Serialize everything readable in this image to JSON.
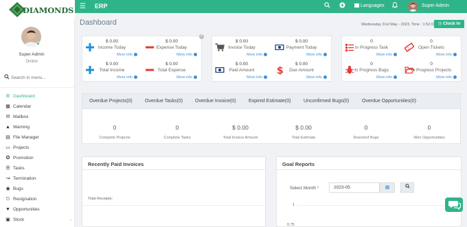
{
  "brand": {
    "logo_text": "DIAMONDS",
    "accent": "#2fb48a"
  },
  "topbar": {
    "app_title": "ERP",
    "languages_label": "Languages",
    "user_name": "Super Admin"
  },
  "sidebar": {
    "user_name": "Super Admin",
    "user_status": "Online",
    "search_placeholder": "Search in menu...",
    "items": [
      {
        "label": "Dashboard",
        "icon": "dashboard-icon",
        "active": true
      },
      {
        "label": "Calendar",
        "icon": "calendar-icon"
      },
      {
        "label": "Mailbox",
        "icon": "mailbox-icon"
      },
      {
        "label": "Warning",
        "icon": "warning-icon"
      },
      {
        "label": "File Manager",
        "icon": "file-manager-icon"
      },
      {
        "label": "Projects",
        "icon": "folder-icon"
      },
      {
        "label": "Promotion",
        "icon": "promotion-icon"
      },
      {
        "label": "Tasks",
        "icon": "tasks-icon"
      },
      {
        "label": "Termination",
        "icon": "termination-icon"
      },
      {
        "label": "Bugs",
        "icon": "bug-icon"
      },
      {
        "label": "Resignation",
        "icon": "resignation-icon"
      },
      {
        "label": "Opportunities",
        "icon": "filter-icon"
      },
      {
        "label": "Stock",
        "icon": "stock-icon"
      }
    ]
  },
  "header": {
    "title": "Dashboard",
    "datetime": "Wednesday 31st May - 2023, Time : 1:52:03",
    "clock_in_label": "Clock In"
  },
  "stats": {
    "more_info": "More info",
    "income_today": {
      "value": "$ 0.00",
      "label": "Income Today"
    },
    "expense_today": {
      "value": "$ 0.00",
      "label": "Expense Today"
    },
    "total_income": {
      "value": "$ 0.00",
      "label": "Total Income"
    },
    "total_expense": {
      "value": "$ 0.00",
      "label": "Total Expense"
    },
    "invoice_today": {
      "value": "$ 0.00",
      "label": "Invoice Today"
    },
    "payment_today": {
      "value": "$ 0.00",
      "label": "Payment Today"
    },
    "paid_amount": {
      "value": "$ 0.00",
      "label": "Paid Amount"
    },
    "due_amount": {
      "value": "$ 0.00",
      "label": "Due Amount"
    },
    "in_progress_task": {
      "value": "0",
      "label": "In Progress Task"
    },
    "open_tickets": {
      "value": "0",
      "label": "Open Tickets"
    },
    "in_progress_bugs": {
      "value": "0",
      "label": "In Progress Bugs"
    },
    "in_progress_projects": {
      "value": "0",
      "label": "In Progress Projects"
    }
  },
  "overdue": {
    "tabs": [
      "Overdue Projects(0)",
      "Overdue Tasks(0)",
      "Overdue Invoice(0)",
      "Expired Estimate(0)",
      "Unconfirmed Bugs(0)",
      "Overdue Opportunities(0)"
    ],
    "stats": [
      {
        "value": "0",
        "label": "Complete Projects"
      },
      {
        "value": "0",
        "label": "Complete Tasks"
      },
      {
        "value": "$ 0.00",
        "label": "Total Invoice Amount"
      },
      {
        "value": "$ 0.00",
        "label": "Total Estimate"
      },
      {
        "value": "0",
        "label": "Resolved Bugs"
      },
      {
        "value": "0",
        "label": "Won Opportunities"
      }
    ]
  },
  "recent_paid": {
    "title": "Recently Paid Invoices",
    "total_receipts": "Total Receipts:"
  },
  "goal_reports": {
    "title": "Goal Reports",
    "select_month_label": "Select Month",
    "required_mark": "*",
    "month_value": "2023-05",
    "y_ticks": [
      "1",
      "0.75"
    ]
  }
}
